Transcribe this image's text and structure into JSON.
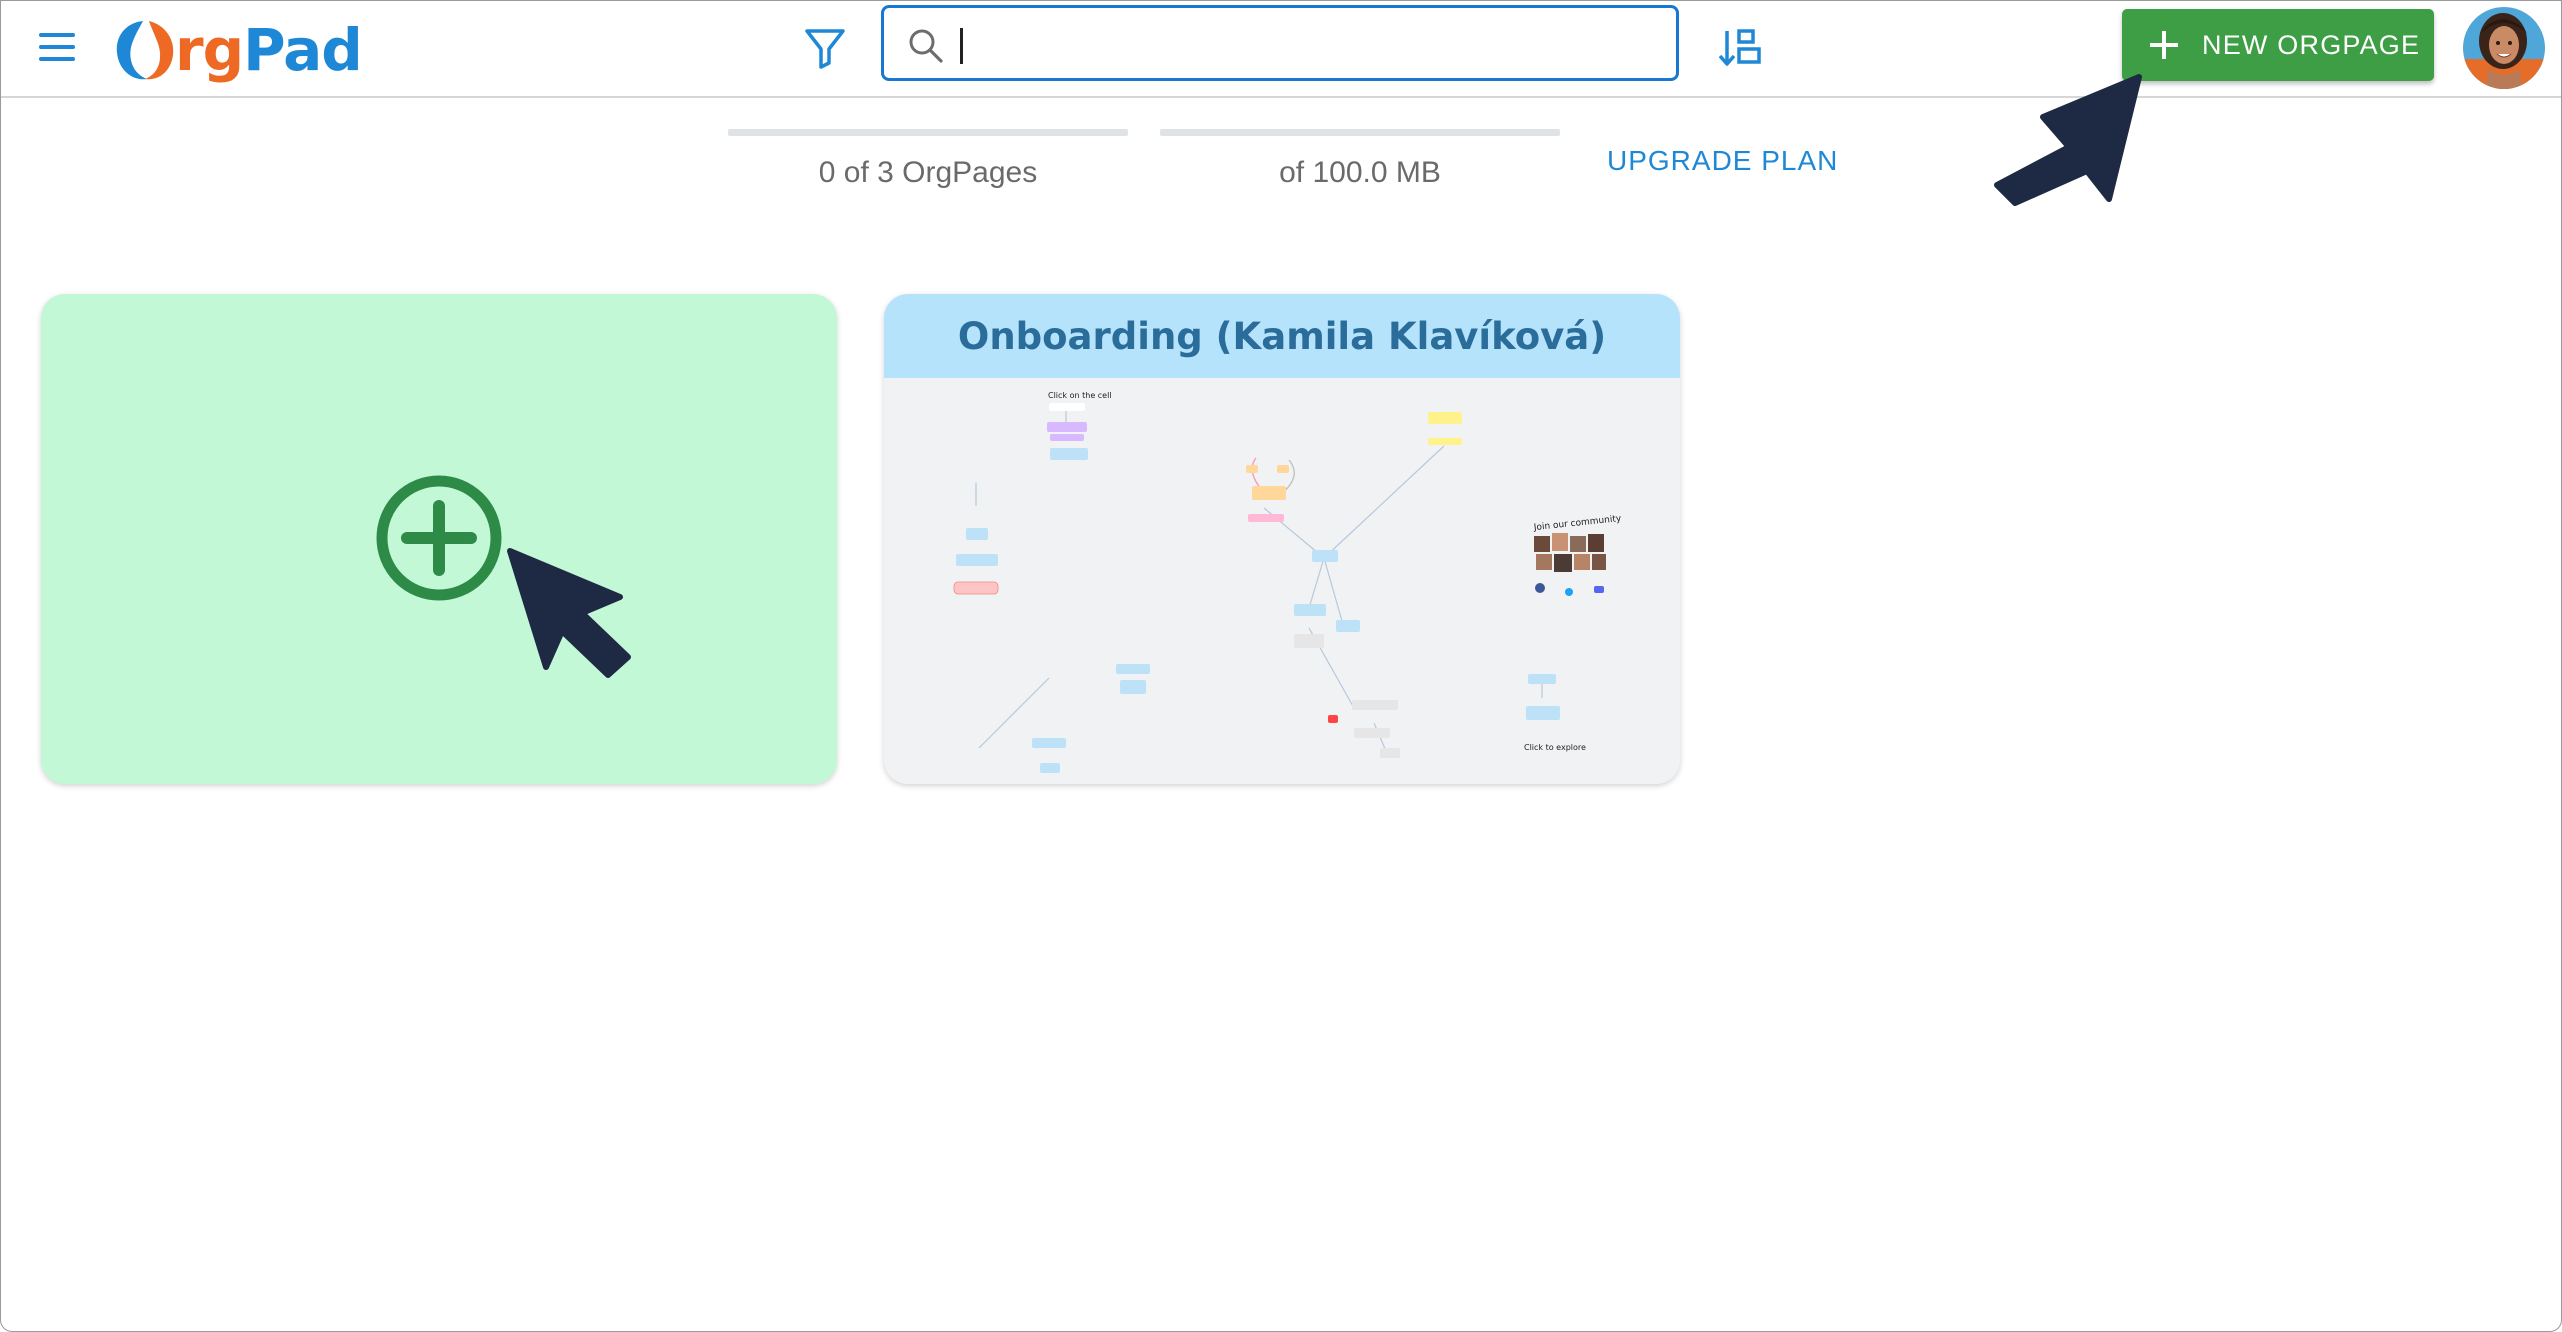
{
  "app": {
    "logo_text_orange": "rg",
    "logo_text_blue": "Pad"
  },
  "header": {
    "menu_icon": "hamburger-menu-icon",
    "filter_icon": "filter-funnel-icon",
    "search": {
      "value": "",
      "placeholder": "",
      "icon": "search-icon"
    },
    "sort_icon": "sort-icon",
    "new_button_label": "NEW ORGPAGE",
    "new_button_icon": "plus-icon",
    "avatar_icon": "user-avatar"
  },
  "usage": {
    "orgpages_text": "0 of 3 OrgPages",
    "orgpages_used_fraction": 0,
    "storage_text": "of 100.0 MB",
    "storage_used_fraction": 0,
    "upgrade_label": "UPGRADE PLAN"
  },
  "cards": {
    "new_card_icon": "add-circle-icon",
    "orgpage": {
      "title": "Onboarding (Kamila Klavíková)",
      "thumb_texts": {
        "top_note": "Click on the cell",
        "community": "Join our community",
        "explore": "Click to explore"
      }
    }
  },
  "colors": {
    "brand_blue": "#1e88d6",
    "brand_orange": "#ee6a24",
    "new_button_green": "#3d9e45",
    "new_card_bg": "#c3f8d6",
    "add_icon_green": "#2e8b47",
    "card_title_band": "#b6e3fc",
    "card_title_text": "#2b6d9a",
    "pointer_dark": "#1e2a44"
  }
}
